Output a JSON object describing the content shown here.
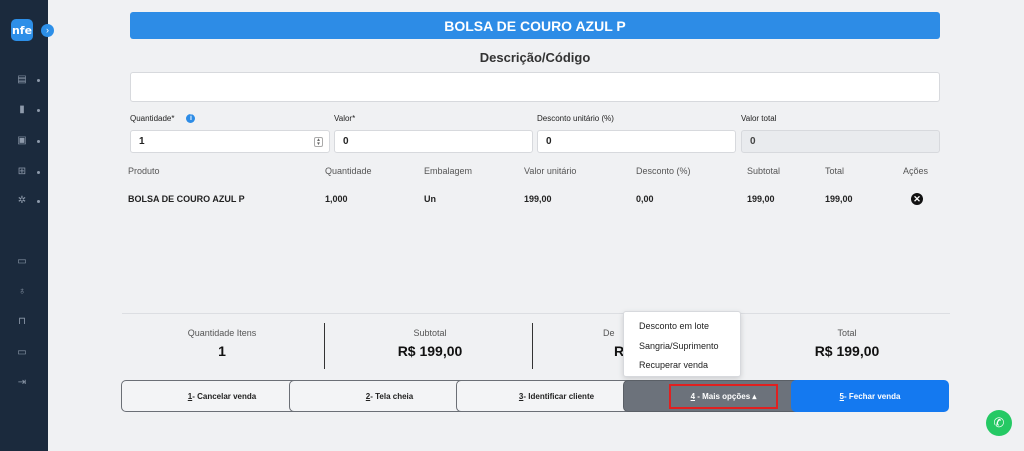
{
  "sidebar": {
    "logo_text": "nfe",
    "collapse_glyph": "›",
    "icons": [
      "dashboard-icon",
      "chart-icon",
      "image-icon",
      "cart-icon",
      "gear-icon",
      "chat-icon",
      "microphone-icon",
      "lock-icon",
      "monitor-icon",
      "exit-icon"
    ]
  },
  "product_title": "BOLSA DE COURO AZUL P",
  "search": {
    "label": "Descrição/Código",
    "value": ""
  },
  "fields": {
    "quantidade_label": "Quantidade*",
    "quantidade_value": "1",
    "valor_label": "Valor*",
    "valor_value": "0",
    "desconto_label": "Desconto unitário (%)",
    "desconto_value": "0",
    "total_label": "Valor total",
    "total_value": "0"
  },
  "table": {
    "headers": [
      "Produto",
      "Quantidade",
      "Embalagem",
      "Valor unitário",
      "Desconto (%)",
      "Subtotal",
      "Total",
      "Ações"
    ],
    "rows": [
      [
        "BOLSA DE COURO AZUL P",
        "1,000",
        "Un",
        "199,00",
        "0,00",
        "199,00",
        "199,00"
      ]
    ]
  },
  "totals": {
    "items_label": "Quantidade Itens",
    "items_value": "1",
    "subtotal_label": "Subtotal",
    "subtotal_value": "R$ 199,00",
    "desc_label_partial": "De",
    "desc_value_partial": "R",
    "total_label": "Total",
    "total_value": "R$ 199,00"
  },
  "dropdown": [
    "Desconto em lote",
    "Sangria/Suprimento",
    "Recuperar venda"
  ],
  "buttons": {
    "b1_key": "1",
    "b1_text": " - Cancelar venda",
    "b2_key": "2",
    "b2_text": " - Tela cheia",
    "b3_key": "3",
    "b3_text": " - Identificar cliente",
    "b4_key": "4",
    "b4_text": " - Mais opções ▴",
    "b5_key": "5",
    "b5_text": " - Fechar venda"
  },
  "colors": {
    "accent": "#2d8ce6",
    "sidebar": "#1b2a3d",
    "whatsapp": "#25c964"
  }
}
